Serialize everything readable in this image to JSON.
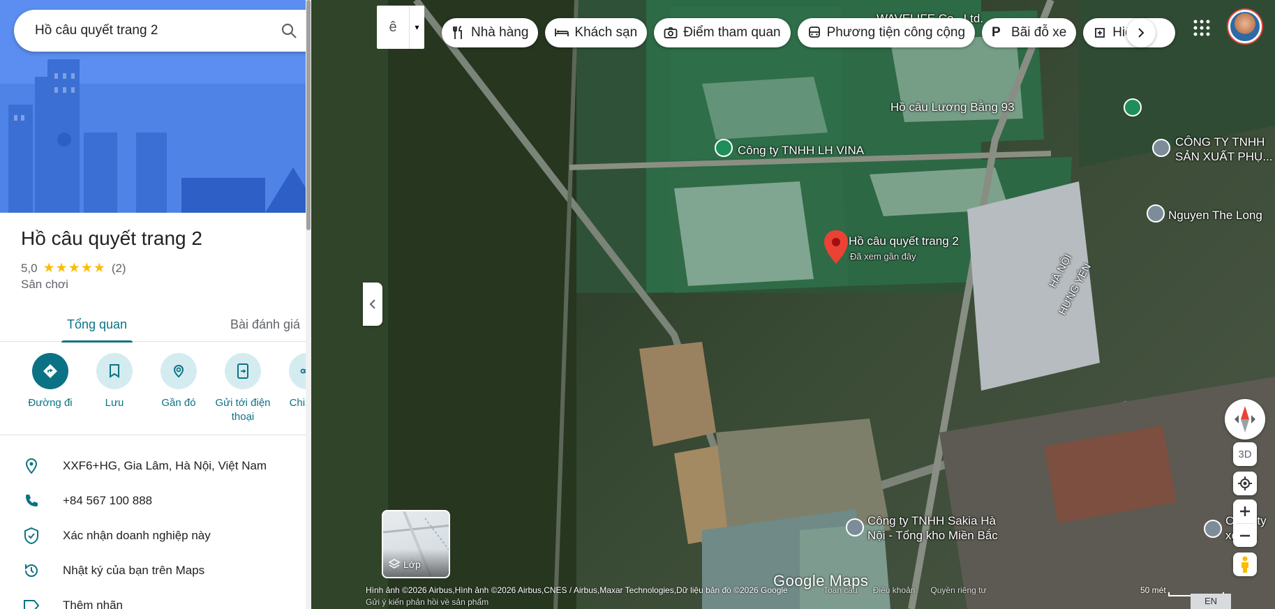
{
  "search": {
    "query": "Hồ câu quyết trang 2"
  },
  "place": {
    "name": "Hồ câu quyết trang 2",
    "rating": "5,0",
    "stars": "★★★★★",
    "review_count": "(2)",
    "category": "Sân chơi"
  },
  "tabs": [
    {
      "label": "Tổng quan"
    },
    {
      "label": "Bài đánh giá"
    }
  ],
  "actions": [
    {
      "label": "Đường đi"
    },
    {
      "label": "Lưu"
    },
    {
      "label": "Gần đó"
    },
    {
      "label": "Gửi tới điện thoại"
    },
    {
      "label": "Chia sẻ"
    }
  ],
  "info": [
    {
      "icon": "location-pin-icon",
      "text": "XXF6+HG, Gia Lâm, Hà Nội, Việt Nam"
    },
    {
      "icon": "phone-icon",
      "text": "+84 567 100 888"
    },
    {
      "icon": "verified-shield-icon",
      "text": "Xác nhận doanh nghiệp này"
    },
    {
      "icon": "history-icon",
      "text": "Nhật ký của bạn trên Maps"
    },
    {
      "icon": "label-icon",
      "text": "Thêm nhãn"
    }
  ],
  "ime": {
    "char": "ê"
  },
  "chips": [
    {
      "icon": "restaurant-icon",
      "label": "Nhà hàng"
    },
    {
      "icon": "hotel-icon",
      "label": "Khách sạn"
    },
    {
      "icon": "camera-icon",
      "label": "Điểm tham quan"
    },
    {
      "icon": "bus-icon",
      "label": "Phương tiện công cộng"
    },
    {
      "icon": "parking-icon",
      "label": "Bãi đỗ xe"
    },
    {
      "icon": "pharmacy-icon",
      "label": "Hiệu t"
    }
  ],
  "map_labels": {
    "waveline": "WAVELIFE Co., Ltd.",
    "road_top": "HƯNG YÊN HÀ NỘI",
    "ho_cau_luong_bang": "Hồ câu Lương Bằng 93",
    "lh_vina": "Công ty TNHH LH VINA",
    "cong_ty_tnhh_sx": "CÔNG TY TNHH SẢN XUẤT PHỤ...",
    "cong_ty_tnhh_sx_l1": "CÔNG TY TNHH",
    "cong_ty_tnhh_sx_l2": "SẢN XUẤT PHỤ...",
    "nguyen_the_long": "Nguyen The Long",
    "selected_place": "Hồ câu quyết trang 2",
    "selected_sub": "Đã xem gần đây",
    "road_mid_1": "HÀ NỘI",
    "road_mid_2": "HƯNG YÊN",
    "sakia_l1": "Công ty TNHH Sakia Hà",
    "sakia_l2": "Nội - Tổng kho Miền Bắc",
    "right_edge_1": "Công ty",
    "right_edge_2": "xe Hà",
    "google": "Google Maps"
  },
  "layers_label": "Lớp",
  "controls": {
    "three_d": "3D"
  },
  "footer": {
    "attribution": "Hình ảnh ©2026 Airbus,Hình ảnh ©2026 Airbus,CNES / Airbus,Maxar Technologies,Dữ liệu bản đồ ©2026 Google",
    "feedback": "Gửi ý kiến phản hồi về sản phẩm",
    "links": [
      "Toàn cầu",
      "Điều khoản",
      "Quyền riêng tư"
    ],
    "scale": "50 mét",
    "lang": "EN"
  },
  "colors": {
    "accent": "#0b7285",
    "hero": "#4a7fe0",
    "star": "#fbbc04",
    "pin_red": "#ea4335"
  }
}
